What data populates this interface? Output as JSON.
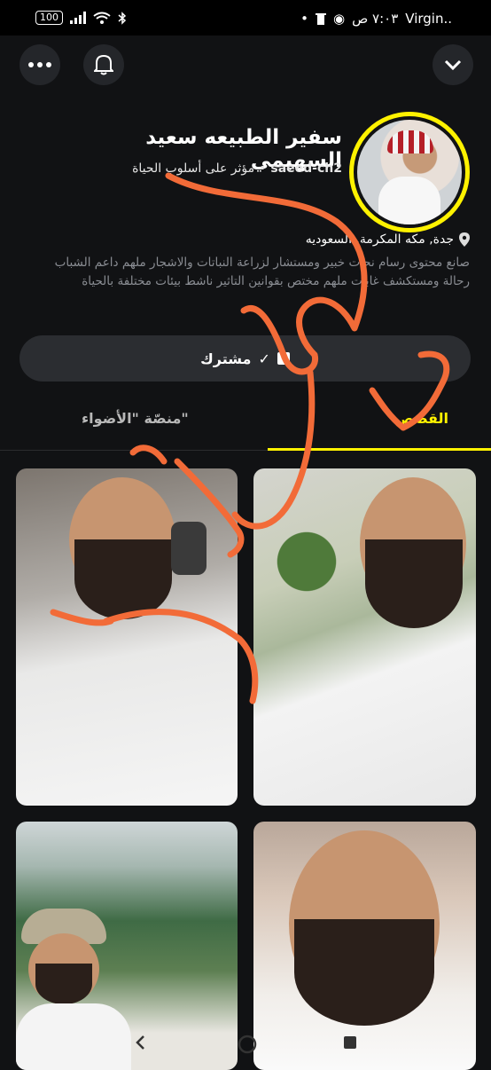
{
  "status_bar": {
    "battery": "100",
    "carrier": "Virgin..",
    "time": "٧:٠٣ ص",
    "dot": "•"
  },
  "header": {
    "menu_icon": "more-dots-icon",
    "bell_icon": "bell-icon",
    "collapse_icon": "chevron-down-icon"
  },
  "profile": {
    "name": "سفير الطبيعه سعيد السهيمي",
    "username": "saeed-ch2",
    "separator": "•",
    "category": "مؤثر على أسلوب الحياة",
    "location": "جدة, مكه المكرمة, السعوديه",
    "bio": "صانع محتوى رسام نحات خبير ومستشار لزراعة النباتات والاشجار ملهم داعم الشباب رحالة ومستكشف غابات ملهم مختص بقوانين التاثير ناشط بيئات مختلفة بالحياة"
  },
  "subscribe_button": {
    "label": "مشترك"
  },
  "tabs": [
    {
      "label": "القصص",
      "active": true
    },
    {
      "label": "منصّة \"الأضواء\"",
      "active": false
    }
  ],
  "colors": {
    "accent": "#fff200",
    "background": "#111214",
    "annotation": "#f26b38"
  }
}
